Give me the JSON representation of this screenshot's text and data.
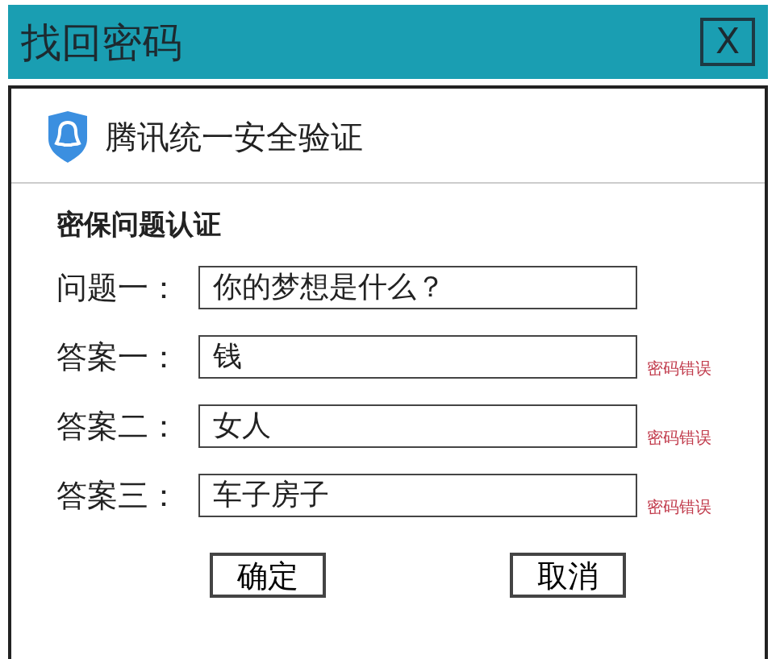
{
  "window": {
    "title": "找回密码",
    "close": "X"
  },
  "header": {
    "title": "腾讯统一安全验证"
  },
  "section": {
    "title": "密保问题认证"
  },
  "rows": [
    {
      "label": "问题一：",
      "value": "你的梦想是什么？"
    },
    {
      "label": "答案一：",
      "value": "钱",
      "error": "密码错误"
    },
    {
      "label": "答案二：",
      "value": "女人",
      "error": "密码错误"
    },
    {
      "label": "答案三：",
      "value": "车子房子",
      "error": "密码错误"
    }
  ],
  "buttons": [
    "确定",
    "取消"
  ]
}
